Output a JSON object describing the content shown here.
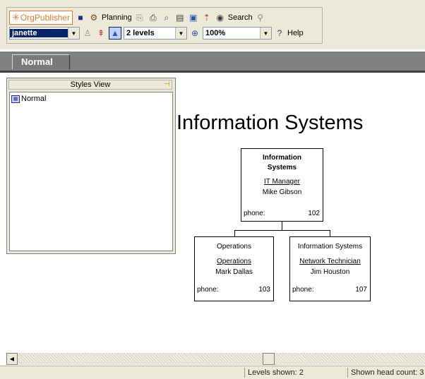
{
  "toolbar": {
    "logo_text": "OrgPublisher",
    "planning_label": "Planning",
    "search_label": "Search",
    "help_label": "Help",
    "user_value": "janette",
    "levels_value": "2 levels",
    "zoom_value": "100%"
  },
  "tabs": [
    {
      "label": "Normal"
    }
  ],
  "styles_view": {
    "title": "Styles View",
    "items": [
      {
        "label": "Normal"
      }
    ]
  },
  "chart": {
    "title": "Information Systems",
    "root": {
      "name_line1": "Information",
      "name_line2": "Systems",
      "role": "IT Manager",
      "person": "Mike Gibson",
      "phone_label": "phone:",
      "phone": "102"
    },
    "children": [
      {
        "name": "Operations",
        "role": "Operations",
        "person": "Mark Dallas",
        "phone_label": "phone:",
        "phone": "103"
      },
      {
        "name": "Information Systems",
        "role": "Network Technician",
        "person": "Jim Houston",
        "phone_label": "phone:",
        "phone": "107"
      }
    ]
  },
  "status": {
    "levels": "Levels shown: 2",
    "headcount": "Shown head count: 3"
  },
  "colors": {
    "accent": "#e07a2a",
    "selection": "#0a246a",
    "tab_strip": "#808080"
  }
}
